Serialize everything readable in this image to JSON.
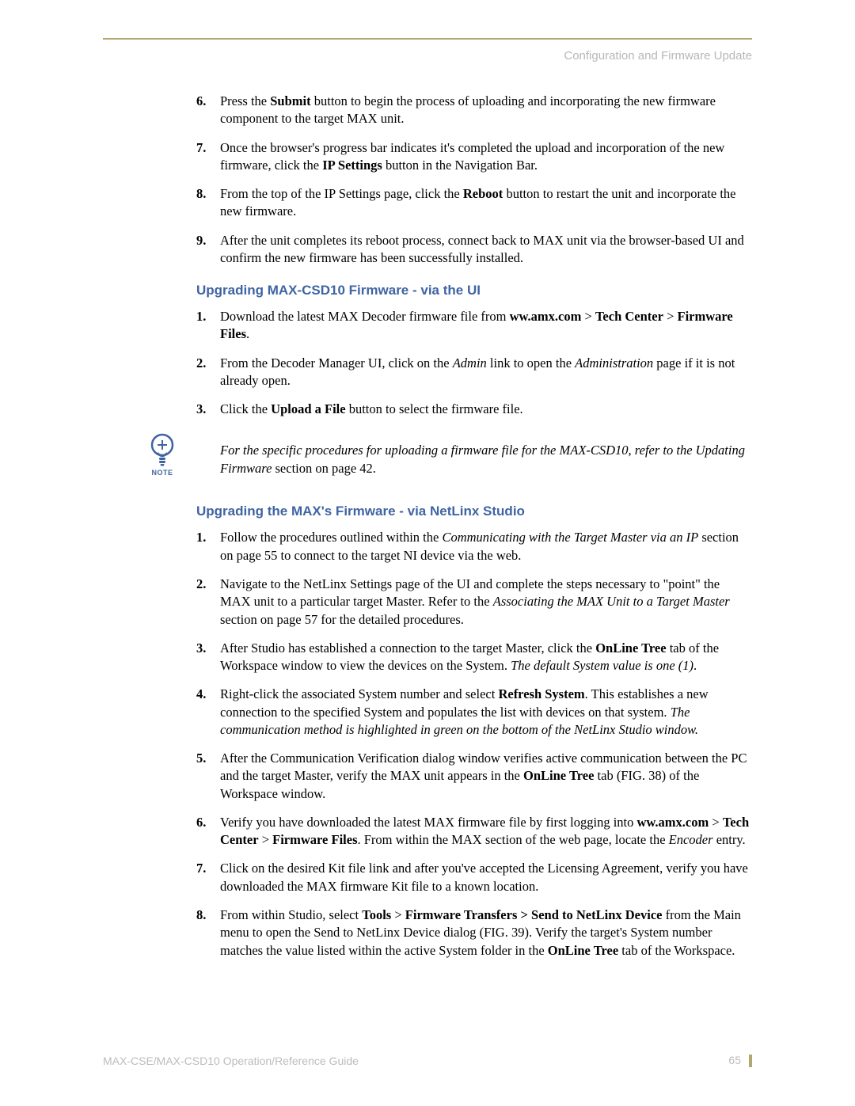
{
  "header": {
    "title": "Configuration and Firmware Update"
  },
  "listA": {
    "items": [
      {
        "num": "6.",
        "html": "Press the <b>Submit</b> button to begin the process of uploading and incorporating the new firmware component to the target MAX unit."
      },
      {
        "num": "7.",
        "html": "Once the browser's progress bar indicates it's completed the upload and incorporation of the new firmware, click the <b>IP Settings</b> button in the Navigation Bar."
      },
      {
        "num": "8.",
        "html": "From the top of the IP Settings page, click the <b>Reboot</b> button to restart the unit and incorporate the new firmware."
      },
      {
        "num": "9.",
        "html": "After the unit completes its reboot process, connect back to MAX unit via the browser-based UI and confirm the new firmware has been successfully installed."
      }
    ]
  },
  "sectionB": {
    "title": "Upgrading MAX-CSD10 Firmware - via the UI"
  },
  "listB": {
    "items": [
      {
        "num": "1.",
        "html": "Download the latest MAX Decoder firmware file from <b>ww.amx.com</b> > <b>Tech Center</b> > <b>Firmware Files</b>."
      },
      {
        "num": "2.",
        "html": "From the Decoder Manager UI, click on the <i>Admin</i> link to open the <i>Administration</i> page if it is not already open."
      },
      {
        "num": "3.",
        "html": "Click the <b>Upload a File</b> button to select the firmware file."
      }
    ]
  },
  "note": {
    "label": "NOTE",
    "html": "For the specific procedures for uploading a firmware file for the MAX-CSD10, refer to the Updating Firmware <span class=\"nonitalic\">section on page 42.</span>"
  },
  "sectionC": {
    "title": "Upgrading the MAX's Firmware - via NetLinx Studio"
  },
  "listC": {
    "items": [
      {
        "num": "1.",
        "html": "Follow the procedures outlined within the <i>Communicating with the Target Master via an IP</i> section on page 55 to connect to the target NI device via the web."
      },
      {
        "num": "2.",
        "html": "Navigate to the NetLinx Settings page of the UI and complete the steps necessary to \"point\" the MAX unit to a particular target Master. Refer to the <i>Associating the MAX Unit to a Target Master</i> section on page 57 for the detailed procedures."
      },
      {
        "num": "3.",
        "html": "After Studio has established a connection to the target Master, click the <b>OnLine Tree</b> tab of the Workspace window to view the devices on the System. <i>The default System value is one (1)</i>."
      },
      {
        "num": "4.",
        "html": "Right-click the associated System number and select <b>Refresh System</b>. This establishes a new connection to the specified System and populates the list with devices on that system. <i>The communication method is highlighted in green on the bottom of the NetLinx Studio window.</i>"
      },
      {
        "num": "5.",
        "html": "After the Communication Verification dialog window verifies active communication between the PC and the target Master, verify the MAX unit appears in the <b>OnLine Tree</b> tab (FIG. 38) of the Workspace window."
      },
      {
        "num": "6.",
        "html": "Verify you have downloaded the latest MAX firmware file by first logging into <b>ww.amx.com</b> > <b>Tech Center</b> > <b>Firmware Files</b>. From within the MAX section of the web page, locate the <i>Encoder</i> entry."
      },
      {
        "num": "7.",
        "html": "Click on the desired Kit file link and after you've accepted the Licensing Agreement, verify you have downloaded the MAX firmware Kit file to a known location."
      },
      {
        "num": "8.",
        "html": "From within Studio, select <b>Tools</b> > <b>Firmware Transfers > Send to NetLinx Device</b> from the Main menu to open the Send to NetLinx Device dialog (FIG. 39). Verify the target's System number matches the value listed within the active System folder in the <b>OnLine Tree</b> tab of the Workspace."
      }
    ]
  },
  "footer": {
    "title": "MAX-CSE/MAX-CSD10 Operation/Reference Guide",
    "page": "65"
  }
}
